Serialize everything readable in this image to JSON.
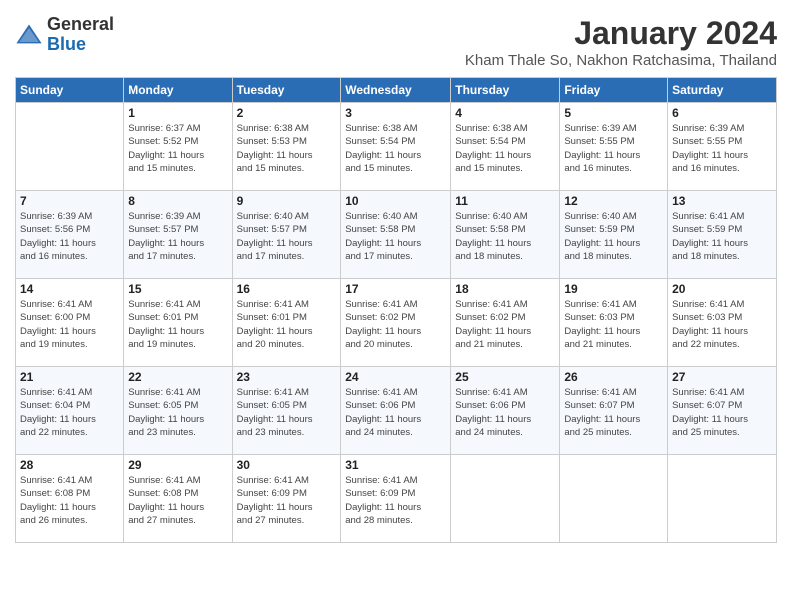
{
  "header": {
    "logo_general": "General",
    "logo_blue": "Blue",
    "month": "January 2024",
    "location": "Kham Thale So, Nakhon Ratchasima, Thailand"
  },
  "columns": [
    "Sunday",
    "Monday",
    "Tuesday",
    "Wednesday",
    "Thursday",
    "Friday",
    "Saturday"
  ],
  "weeks": [
    [
      {
        "num": "",
        "info": ""
      },
      {
        "num": "1",
        "info": "Sunrise: 6:37 AM\nSunset: 5:52 PM\nDaylight: 11 hours\nand 15 minutes."
      },
      {
        "num": "2",
        "info": "Sunrise: 6:38 AM\nSunset: 5:53 PM\nDaylight: 11 hours\nand 15 minutes."
      },
      {
        "num": "3",
        "info": "Sunrise: 6:38 AM\nSunset: 5:54 PM\nDaylight: 11 hours\nand 15 minutes."
      },
      {
        "num": "4",
        "info": "Sunrise: 6:38 AM\nSunset: 5:54 PM\nDaylight: 11 hours\nand 15 minutes."
      },
      {
        "num": "5",
        "info": "Sunrise: 6:39 AM\nSunset: 5:55 PM\nDaylight: 11 hours\nand 16 minutes."
      },
      {
        "num": "6",
        "info": "Sunrise: 6:39 AM\nSunset: 5:55 PM\nDaylight: 11 hours\nand 16 minutes."
      }
    ],
    [
      {
        "num": "7",
        "info": "Sunrise: 6:39 AM\nSunset: 5:56 PM\nDaylight: 11 hours\nand 16 minutes."
      },
      {
        "num": "8",
        "info": "Sunrise: 6:39 AM\nSunset: 5:57 PM\nDaylight: 11 hours\nand 17 minutes."
      },
      {
        "num": "9",
        "info": "Sunrise: 6:40 AM\nSunset: 5:57 PM\nDaylight: 11 hours\nand 17 minutes."
      },
      {
        "num": "10",
        "info": "Sunrise: 6:40 AM\nSunset: 5:58 PM\nDaylight: 11 hours\nand 17 minutes."
      },
      {
        "num": "11",
        "info": "Sunrise: 6:40 AM\nSunset: 5:58 PM\nDaylight: 11 hours\nand 18 minutes."
      },
      {
        "num": "12",
        "info": "Sunrise: 6:40 AM\nSunset: 5:59 PM\nDaylight: 11 hours\nand 18 minutes."
      },
      {
        "num": "13",
        "info": "Sunrise: 6:41 AM\nSunset: 5:59 PM\nDaylight: 11 hours\nand 18 minutes."
      }
    ],
    [
      {
        "num": "14",
        "info": "Sunrise: 6:41 AM\nSunset: 6:00 PM\nDaylight: 11 hours\nand 19 minutes."
      },
      {
        "num": "15",
        "info": "Sunrise: 6:41 AM\nSunset: 6:01 PM\nDaylight: 11 hours\nand 19 minutes."
      },
      {
        "num": "16",
        "info": "Sunrise: 6:41 AM\nSunset: 6:01 PM\nDaylight: 11 hours\nand 20 minutes."
      },
      {
        "num": "17",
        "info": "Sunrise: 6:41 AM\nSunset: 6:02 PM\nDaylight: 11 hours\nand 20 minutes."
      },
      {
        "num": "18",
        "info": "Sunrise: 6:41 AM\nSunset: 6:02 PM\nDaylight: 11 hours\nand 21 minutes."
      },
      {
        "num": "19",
        "info": "Sunrise: 6:41 AM\nSunset: 6:03 PM\nDaylight: 11 hours\nand 21 minutes."
      },
      {
        "num": "20",
        "info": "Sunrise: 6:41 AM\nSunset: 6:03 PM\nDaylight: 11 hours\nand 22 minutes."
      }
    ],
    [
      {
        "num": "21",
        "info": "Sunrise: 6:41 AM\nSunset: 6:04 PM\nDaylight: 11 hours\nand 22 minutes."
      },
      {
        "num": "22",
        "info": "Sunrise: 6:41 AM\nSunset: 6:05 PM\nDaylight: 11 hours\nand 23 minutes."
      },
      {
        "num": "23",
        "info": "Sunrise: 6:41 AM\nSunset: 6:05 PM\nDaylight: 11 hours\nand 23 minutes."
      },
      {
        "num": "24",
        "info": "Sunrise: 6:41 AM\nSunset: 6:06 PM\nDaylight: 11 hours\nand 24 minutes."
      },
      {
        "num": "25",
        "info": "Sunrise: 6:41 AM\nSunset: 6:06 PM\nDaylight: 11 hours\nand 24 minutes."
      },
      {
        "num": "26",
        "info": "Sunrise: 6:41 AM\nSunset: 6:07 PM\nDaylight: 11 hours\nand 25 minutes."
      },
      {
        "num": "27",
        "info": "Sunrise: 6:41 AM\nSunset: 6:07 PM\nDaylight: 11 hours\nand 25 minutes."
      }
    ],
    [
      {
        "num": "28",
        "info": "Sunrise: 6:41 AM\nSunset: 6:08 PM\nDaylight: 11 hours\nand 26 minutes."
      },
      {
        "num": "29",
        "info": "Sunrise: 6:41 AM\nSunset: 6:08 PM\nDaylight: 11 hours\nand 27 minutes."
      },
      {
        "num": "30",
        "info": "Sunrise: 6:41 AM\nSunset: 6:09 PM\nDaylight: 11 hours\nand 27 minutes."
      },
      {
        "num": "31",
        "info": "Sunrise: 6:41 AM\nSunset: 6:09 PM\nDaylight: 11 hours\nand 28 minutes."
      },
      {
        "num": "",
        "info": ""
      },
      {
        "num": "",
        "info": ""
      },
      {
        "num": "",
        "info": ""
      }
    ]
  ]
}
